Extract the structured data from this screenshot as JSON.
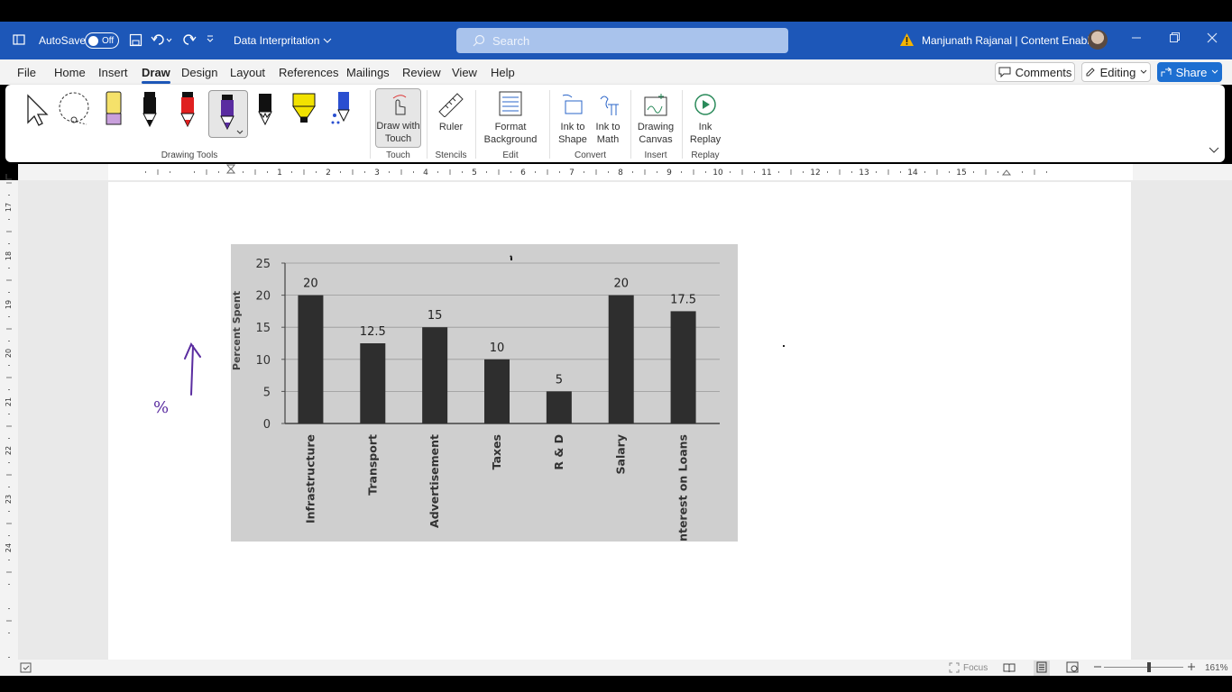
{
  "titlebar": {
    "autosave_label": "AutoSave",
    "autosave_state": "Off",
    "doc_title": "Data Interpritation",
    "search_placeholder": "Search",
    "user": "Manjunath Rajanal | Content Enablers"
  },
  "menu": {
    "tabs": [
      "File",
      "Home",
      "Insert",
      "Draw",
      "Design",
      "Layout",
      "References",
      "Mailings",
      "Review",
      "View",
      "Help"
    ],
    "active": "Draw",
    "comments": "Comments",
    "editing": "Editing",
    "share": "Share"
  },
  "ribbon": {
    "groups": {
      "drawing_tools": "Drawing Tools",
      "touch": "Touch",
      "stencils": "Stencils",
      "edit": "Edit",
      "convert": "Convert",
      "insert": "Insert",
      "replay": "Replay"
    },
    "buttons": {
      "draw_touch_1": "Draw with",
      "draw_touch_2": "Touch",
      "ruler": "Ruler",
      "format_bg_1": "Format",
      "format_bg_2": "Background",
      "ink_shape_1": "Ink to",
      "ink_shape_2": "Shape",
      "ink_math_1": "Ink to",
      "ink_math_2": "Math",
      "drawing_canvas_1": "Drawing",
      "drawing_canvas_2": "Canvas",
      "ink_replay_1": "Ink",
      "ink_replay_2": "Replay"
    },
    "pen_colors": [
      "#111111",
      "#e02020",
      "#5a2ca0",
      "#111111",
      "#f2e200",
      "#2a4fd0"
    ]
  },
  "ruler": {
    "h_numbers": [
      "1",
      "2",
      "3",
      "4",
      "5",
      "6",
      "7",
      "8",
      "9",
      "10",
      "11",
      "12",
      "13",
      "14",
      "15"
    ],
    "v_numbers": [
      "17",
      "18",
      "19",
      "20",
      "21",
      "22",
      "23",
      "24"
    ]
  },
  "chart_data": {
    "type": "bar",
    "categories": [
      "Infrastructure",
      "Transport",
      "Advertisement",
      "Taxes",
      "R & D",
      "Salary",
      "Interest on Loans"
    ],
    "values": [
      20,
      12.5,
      15,
      10,
      5,
      20,
      17.5
    ],
    "value_labels": [
      "20",
      "12.5",
      "15",
      "10",
      "5",
      "20",
      "17.5"
    ],
    "ylabel": "Percent Spent",
    "ylim": [
      0,
      25
    ],
    "yticks": [
      "0",
      "5",
      "10",
      "15",
      "20",
      "25"
    ],
    "grid": true
  },
  "annotation": {
    "ink_text": "%"
  },
  "status": {
    "focus": "Focus",
    "zoom": "161%"
  }
}
